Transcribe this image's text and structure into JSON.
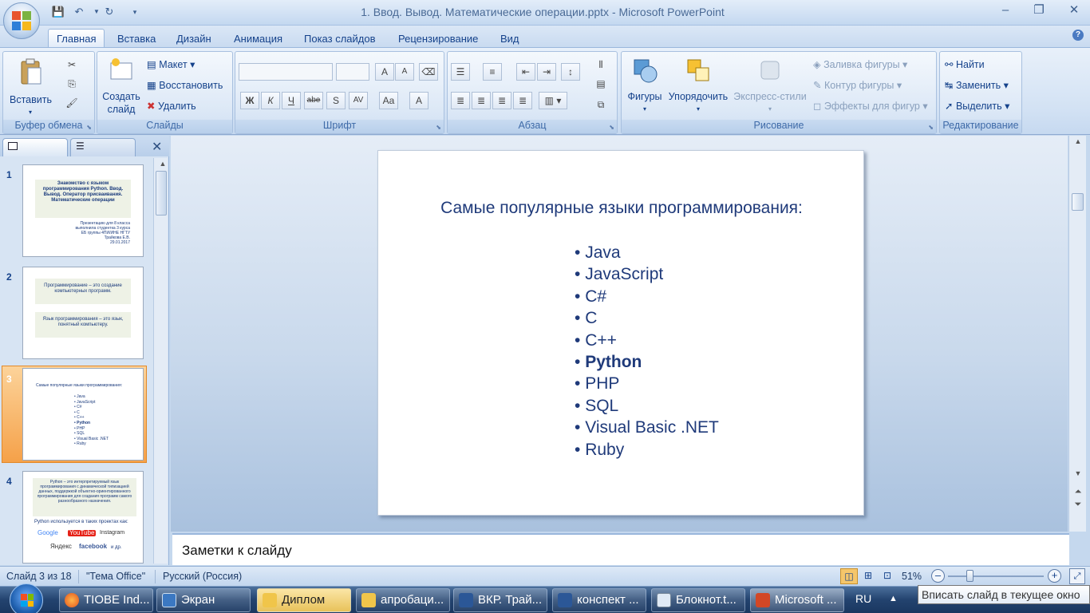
{
  "window": {
    "title": "1. Ввод. Вывод. Математические операции.pptx - Microsoft PowerPoint"
  },
  "tabs": [
    "Главная",
    "Вставка",
    "Дизайн",
    "Анимация",
    "Показ слайдов",
    "Рецензирование",
    "Вид"
  ],
  "ribbon": {
    "clipboard": {
      "label": "Буфер обмена",
      "paste": "Вставить"
    },
    "slides": {
      "label": "Слайды",
      "create": "Создать слайд",
      "layout": "Макет",
      "reset": "Восстановить",
      "delete": "Удалить"
    },
    "font": {
      "label": "Шрифт"
    },
    "paragraph": {
      "label": "Абзац"
    },
    "drawing": {
      "label": "Рисование",
      "shapes": "Фигуры",
      "arrange": "Упорядочить",
      "quick_styles": "Экспресс-стили",
      "fill": "Заливка фигуры",
      "outline": "Контур фигуры",
      "effects": "Эффекты для фигур"
    },
    "editing": {
      "label": "Редактирование",
      "find": "Найти",
      "replace": "Заменить",
      "select": "Выделить"
    }
  },
  "thumbnails": [
    {
      "num": "1",
      "title": "Знакомство с языком программирования Python. Ввод. Вывод. Оператор присваивания. Математические операции",
      "sub": [
        "Презентацию для 8 класса",
        "выполнила студентка 3 курса",
        "ЕБ группы 4ПИ/ИНЕ НГТУ",
        "Трайкова Е.В.",
        "29.01.2017"
      ]
    },
    {
      "num": "2",
      "box1": "Программирование – это создание компьютерных программ.",
      "box2": "Язык программирования – это язык, понятный компьютеру."
    },
    {
      "num": "3",
      "title": "Самые популярные языки программирования:",
      "items": [
        "Java",
        "JavaScript",
        "C#",
        "C",
        "C++",
        "Python",
        "PHP",
        "SQL",
        "Visual Basic .NET",
        "Ruby"
      ]
    },
    {
      "num": "4",
      "box1": "Python – это интерпретируемый язык программирования с динамической типизацией данных, поддержкой объектно-ориентированного программирования для создания программ самого разнообразного назначения.",
      "line": "Python используется в таких проектах как:",
      "logos": [
        "Google",
        "YouTube",
        "Instagram",
        "Яндекс",
        "facebook",
        "и др."
      ]
    }
  ],
  "slide": {
    "title": "Самые популярные  языки программирования:",
    "bullets": [
      "Java",
      "JavaScript",
      "C#",
      "C",
      "C++",
      "Python",
      "PHP",
      "SQL",
      "Visual Basic .NET",
      "Ruby"
    ],
    "bold_index": 5
  },
  "notes": {
    "placeholder": "Заметки к слайду"
  },
  "status": {
    "slide": "Слайд 3 из 18",
    "theme": "\"Тема Office\"",
    "language": "Русский (Россия)",
    "zoom": "51%",
    "zoom_fraction": 0.51
  },
  "taskbar": {
    "items": [
      "TIOBE Ind...",
      "Экран",
      "Диплом",
      "апробаци...",
      "ВКР. Трай...",
      "конспект ...",
      "Блокнот.t...",
      "Microsoft ..."
    ],
    "lang": "RU"
  },
  "tooltip": "Вписать слайд в текущее окно",
  "colors": {
    "accent": "#f5a149",
    "slide_text": "#1f3a7a",
    "ribbon": "#d3e2f4"
  }
}
